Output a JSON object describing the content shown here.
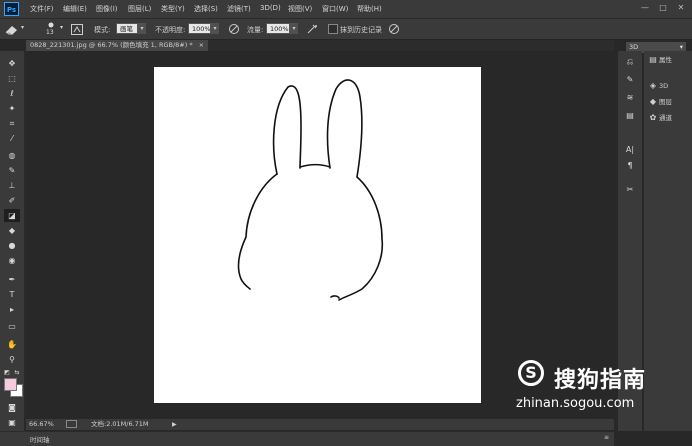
{
  "app": {
    "logo": "Ps"
  },
  "menu": [
    "文件(F)",
    "编辑(E)",
    "图像(I)",
    "图层(L)",
    "类型(Y)",
    "选择(S)",
    "滤镜(T)",
    "3D(D)",
    "视图(V)",
    "窗口(W)",
    "帮助(H)"
  ],
  "window_controls": [
    "—",
    "□",
    "✕"
  ],
  "options": {
    "brush_size": "13",
    "mode_label": "模式:",
    "mode_value": "画笔",
    "opacity_label": "不透明度:",
    "opacity_value": "100%",
    "flow_label": "流量:",
    "flow_value": "100%",
    "history_label": "抹到历史记录",
    "workspace": "3D"
  },
  "document_tab": "0828_221301.jpg @ 66.7% (颜色填充 1, RGB/8#) *",
  "status": {
    "zoom": "66.67%",
    "doc_info": "文档:2.01M/6.71M"
  },
  "timeline_label": "时间轴",
  "panels": [
    {
      "icon": "properties-icon",
      "label": "属性"
    },
    {
      "icon": "3d-icon",
      "label": "3D"
    },
    {
      "icon": "layers-icon",
      "label": "图层"
    },
    {
      "icon": "channels-icon",
      "label": "通道"
    }
  ],
  "watermark": {
    "letter": "S",
    "text": "搜狗指南",
    "url": "zhinan.sogou.com"
  }
}
